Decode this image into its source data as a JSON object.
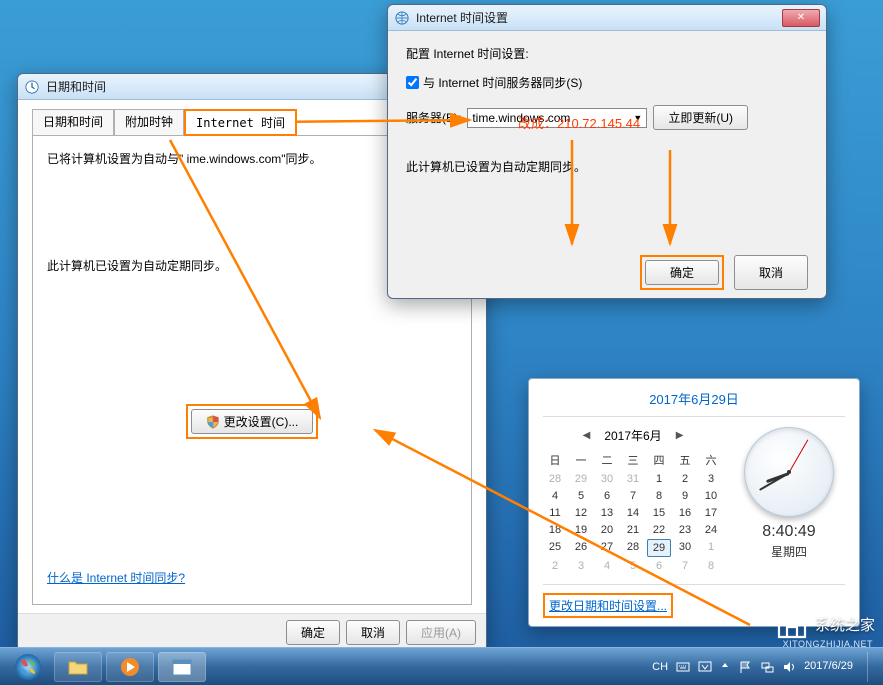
{
  "dlg1": {
    "title": "日期和时间",
    "tabs": [
      "日期和时间",
      "附加时钟",
      "Internet 时间"
    ],
    "line1": "已将计算机设置为自动与\"   ime.windows.com\"同步。",
    "line2": "此计算机已设置为自动定期同步。",
    "change_btn": "更改设置(C)...",
    "help_link": "什么是 Internet 时间同步?",
    "ok": "确定",
    "cancel": "取消",
    "apply": "应用(A)"
  },
  "dlg2": {
    "title": "Internet 时间设置",
    "heading": "配置 Internet 时间设置:",
    "chk_label": "与 Internet 时间服务器同步(S)",
    "server_label": "服务器(E):",
    "server_value": "time.windows.com",
    "update_btn": "立即更新(U)",
    "note": "此计算机已设置为自动定期同步。",
    "ok": "确定",
    "cancel": "取消",
    "annotation": "改成：210.72.145.44"
  },
  "flyout": {
    "date_full": "2017年6月29日",
    "month_label": "2017年6月",
    "dow": [
      "日",
      "一",
      "二",
      "三",
      "四",
      "五",
      "六"
    ],
    "days_gray_start": [
      28,
      29,
      30,
      31
    ],
    "days": [
      1,
      2,
      3,
      4,
      5,
      6,
      7,
      8,
      9,
      10,
      11,
      12,
      13,
      14,
      15,
      16,
      17,
      18,
      19,
      20,
      21,
      22,
      23,
      24,
      25,
      26,
      27,
      28,
      29,
      30
    ],
    "days_gray_end": [
      1,
      2,
      3,
      4,
      5,
      6,
      7,
      8
    ],
    "today": 29,
    "time": "8:40:49",
    "dow_label": "星期四",
    "change_link": "更改日期和时间设置..."
  },
  "taskbar": {
    "ime": "CH",
    "date": "2017/6/29"
  },
  "watermark": {
    "text": "系统之家",
    "sub": "XITONGZHIJIA.NET"
  }
}
